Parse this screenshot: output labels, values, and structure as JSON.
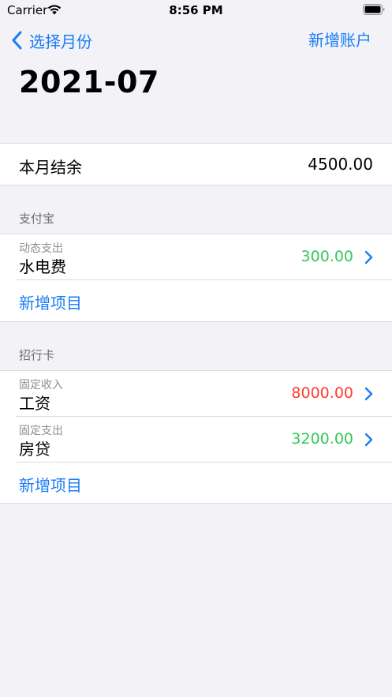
{
  "status_bar": {
    "carrier": "Carrier",
    "time": "8:56 PM"
  },
  "nav": {
    "back_label": "选择月份",
    "action_label": "新增账户"
  },
  "title": "2021-07",
  "summary": {
    "label": "本月结余",
    "value": "4500.00"
  },
  "colors": {
    "accent": "#1a7cf5",
    "expense": "#34c759",
    "income": "#ff3b30"
  },
  "accounts": [
    {
      "name": "支付宝",
      "items": [
        {
          "category": "动态支出",
          "name": "水电费",
          "amount": "300.00",
          "type": "expense"
        }
      ],
      "add_label": "新增项目"
    },
    {
      "name": "招行卡",
      "items": [
        {
          "category": "固定收入",
          "name": "工资",
          "amount": "8000.00",
          "type": "income"
        },
        {
          "category": "固定支出",
          "name": "房贷",
          "amount": "3200.00",
          "type": "expense"
        }
      ],
      "add_label": "新增项目"
    }
  ]
}
